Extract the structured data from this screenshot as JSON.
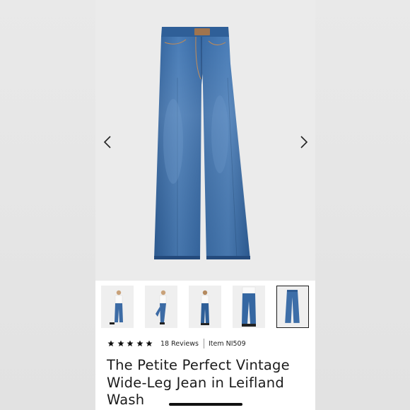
{
  "gallery": {
    "prev_icon": "chevron-left-icon",
    "next_icon": "chevron-right-icon",
    "image_subject": "high-rise wide-leg jeans, medium blue wash",
    "thumbnails": [
      {
        "name": "thumb-model-front"
      },
      {
        "name": "thumb-model-side"
      },
      {
        "name": "thumb-model-back"
      },
      {
        "name": "thumb-model-detail"
      },
      {
        "name": "thumb-flat-lay"
      }
    ]
  },
  "product": {
    "rating_stars": 5,
    "reviews_label": "18 Reviews",
    "item_label": "Item NI509",
    "title": "The Petite Perfect Vintage Wide-Leg Jean in Leifland Wash"
  },
  "colors": {
    "denim": "#3d6ea8",
    "denim_dark": "#2d5a91",
    "text": "#1b1b1b"
  }
}
